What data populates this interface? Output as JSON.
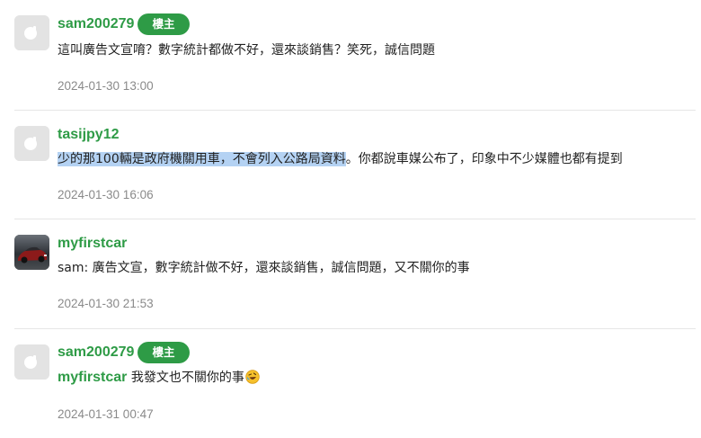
{
  "comments": [
    {
      "username": "sam200279",
      "badge": "樓主",
      "content": "這叫廣告文宣唷？數字統計都做不好，還來談銷售？笑死，誠信問題",
      "timestamp": "2024-01-30 13:00",
      "avatar_icon": "default-avatar-icon"
    },
    {
      "username": "tasijpy12",
      "content_highlight": "少的那100輛是政府機關用車，不會列入公路局資料",
      "content_rest": "。你都說車媒公布了，印象中不少媒體也都有提到",
      "timestamp": "2024-01-30 16:06",
      "avatar_icon": "default-avatar-icon"
    },
    {
      "username": "myfirstcar",
      "content": "sam: 廣告文宣，數字統計做不好，還來談銷售，誠信問題，又不關你的事",
      "timestamp": "2024-01-30 21:53",
      "avatar_icon": "car-photo-avatar"
    },
    {
      "username": "sam200279",
      "badge": "樓主",
      "reply_to": "myfirstcar",
      "content": " 我發文也不關你的事",
      "emoji": "rolling-laughing-emoji",
      "timestamp": "2024-01-31 00:47",
      "avatar_icon": "default-avatar-icon"
    }
  ],
  "colors": {
    "username_green": "#2e9b46",
    "badge_green": "#2e9b46",
    "highlight_blue": "#b4d2f3",
    "timestamp_gray": "#8a8a8a",
    "divider": "#e6e6e6"
  }
}
